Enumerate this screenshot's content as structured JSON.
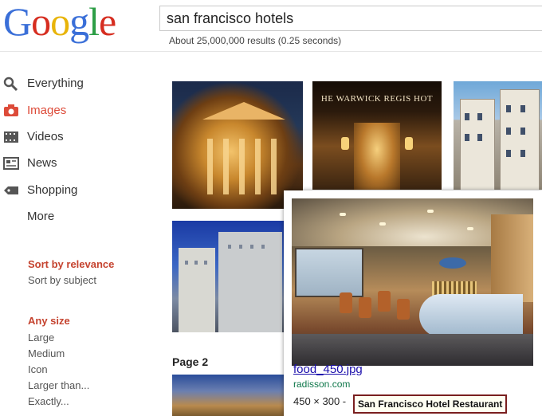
{
  "header": {
    "logo": {
      "letters": [
        "G",
        "o",
        "o",
        "g",
        "l",
        "e"
      ]
    },
    "search": {
      "query": "san francisco hotels"
    },
    "result_stats": "About 25,000,000 results (0.25 seconds)"
  },
  "sidebar": {
    "nav": [
      {
        "label": "Everything",
        "icon": "search-icon",
        "active": false
      },
      {
        "label": "Images",
        "icon": "camera-icon",
        "active": true
      },
      {
        "label": "Videos",
        "icon": "film-icon",
        "active": false
      },
      {
        "label": "News",
        "icon": "newspaper-icon",
        "active": false
      },
      {
        "label": "Shopping",
        "icon": "tag-icon",
        "active": false
      },
      {
        "label": "More",
        "icon": "",
        "active": false
      }
    ],
    "sort": {
      "heading": "Sort by relevance",
      "options": [
        "Sort by subject"
      ]
    },
    "size": {
      "heading": "Any size",
      "options": [
        "Large",
        "Medium",
        "Icon",
        "Larger than...",
        "Exactly..."
      ]
    }
  },
  "results": {
    "thumbnails": [
      {
        "sign": ""
      },
      {
        "sign": "HE WARWICK REGIS HOT"
      },
      {
        "sign": ""
      },
      {
        "sign": ""
      },
      {
        "sign": ""
      }
    ],
    "page_label": "Page 2"
  },
  "preview": {
    "title": "food_450.jpg",
    "url": "radisson.com",
    "dims": "450 × 300 -",
    "tooltip": "San Francisco Hotel Restaurant"
  },
  "colors": {
    "active_nav": "#dd4b39",
    "filter_heading": "#c5432f",
    "link": "#1a0dab",
    "url": "#0e774a",
    "tooltip_border": "#7a1f1f"
  }
}
